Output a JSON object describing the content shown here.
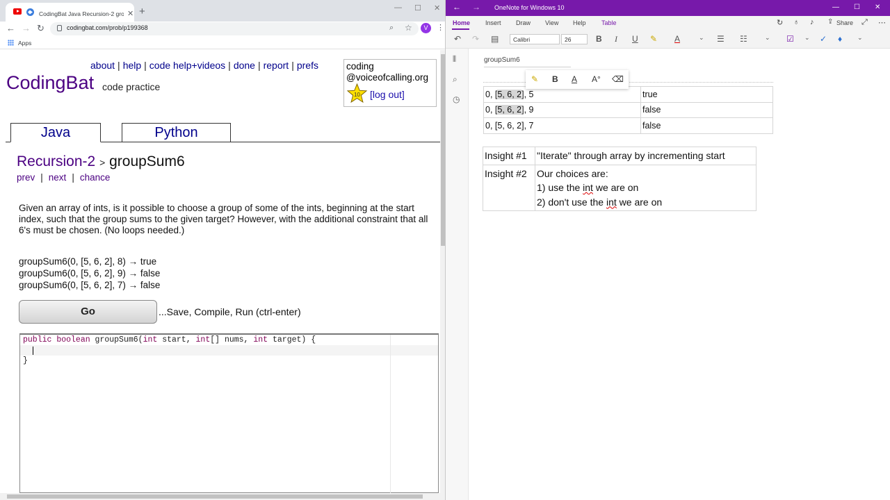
{
  "chrome": {
    "tab_title": "CodingBat Java Recursion-2 grou",
    "url": "codingbat.com/prob/p199368",
    "profile_initial": "V",
    "bookmarks": {
      "apps_label": "Apps"
    }
  },
  "codingbat": {
    "topnav": [
      "about",
      "help",
      "code help+videos",
      "done",
      "report",
      "prefs"
    ],
    "user": {
      "line1": "coding",
      "line2": "@voiceofcalling.org",
      "star_count": "10",
      "logout": "[log out]"
    },
    "logo": "CodingBat",
    "tagline": "code practice",
    "tabs": {
      "java": "Java",
      "python": "Python"
    },
    "crumb": {
      "section": "Recursion-2",
      "arrow": ">",
      "problem": "groupSum6"
    },
    "nav": {
      "prev": "prev",
      "sep": "|",
      "next": "next",
      "chance": "chance"
    },
    "description": "Given an array of ints, is it possible to choose a group of some of the ints, beginning at the start index, such that the group sums to the given target? However, with the additional constraint that all 6's must be chosen. (No loops needed.)",
    "examples": [
      "groupSum6(0, [5, 6, 2], 8) → true",
      "groupSum6(0, [5, 6, 2], 9) → false",
      "groupSum6(0, [5, 6, 2], 7) → false"
    ],
    "go_label": "Go",
    "go_hint": "...Save, Compile, Run (ctrl-enter)",
    "code": {
      "kw_public": "public",
      "kw_boolean": "boolean",
      "method": "groupSum6(",
      "kw_int1": "int",
      "p1": "start,",
      "kw_int2": "int",
      "p2": "[] nums,",
      "kw_int3": "int",
      "p3": "target) {",
      "close": "}"
    }
  },
  "onenote": {
    "window_title": "OneNote for Windows 10",
    "menu": [
      "Home",
      "Insert",
      "Draw",
      "View",
      "Help",
      "Table"
    ],
    "share_label": "Share",
    "font_name": "Calibri",
    "font_size": "26",
    "page_title": "groupSum6",
    "test_rows": [
      {
        "pre": "0, [",
        "hl": "5, 6, 2",
        "post": "], 5",
        "result": "true"
      },
      {
        "pre": "0, [",
        "hl": "5, 6, 2",
        "post": "], 9",
        "result": "false"
      },
      {
        "pre": "0, [5, 6, 2], 7",
        "hl": "",
        "post": "",
        "result": "false"
      }
    ],
    "insights": [
      {
        "key": "Insight #1",
        "text": "\"Iterate\" through array by incrementing start"
      },
      {
        "key": "Insight #2",
        "l1": "Our choices are:",
        "l2a": "1) use the ",
        "l2b": "int",
        "l2c": " we are on",
        "l3a": "2) don't use the ",
        "l3b": "int",
        "l3c": " we are on"
      }
    ]
  },
  "colors": {
    "onenote_purple": "#7719aa",
    "codingbat_purple": "#4b0082",
    "link_blue": "#00008b"
  }
}
